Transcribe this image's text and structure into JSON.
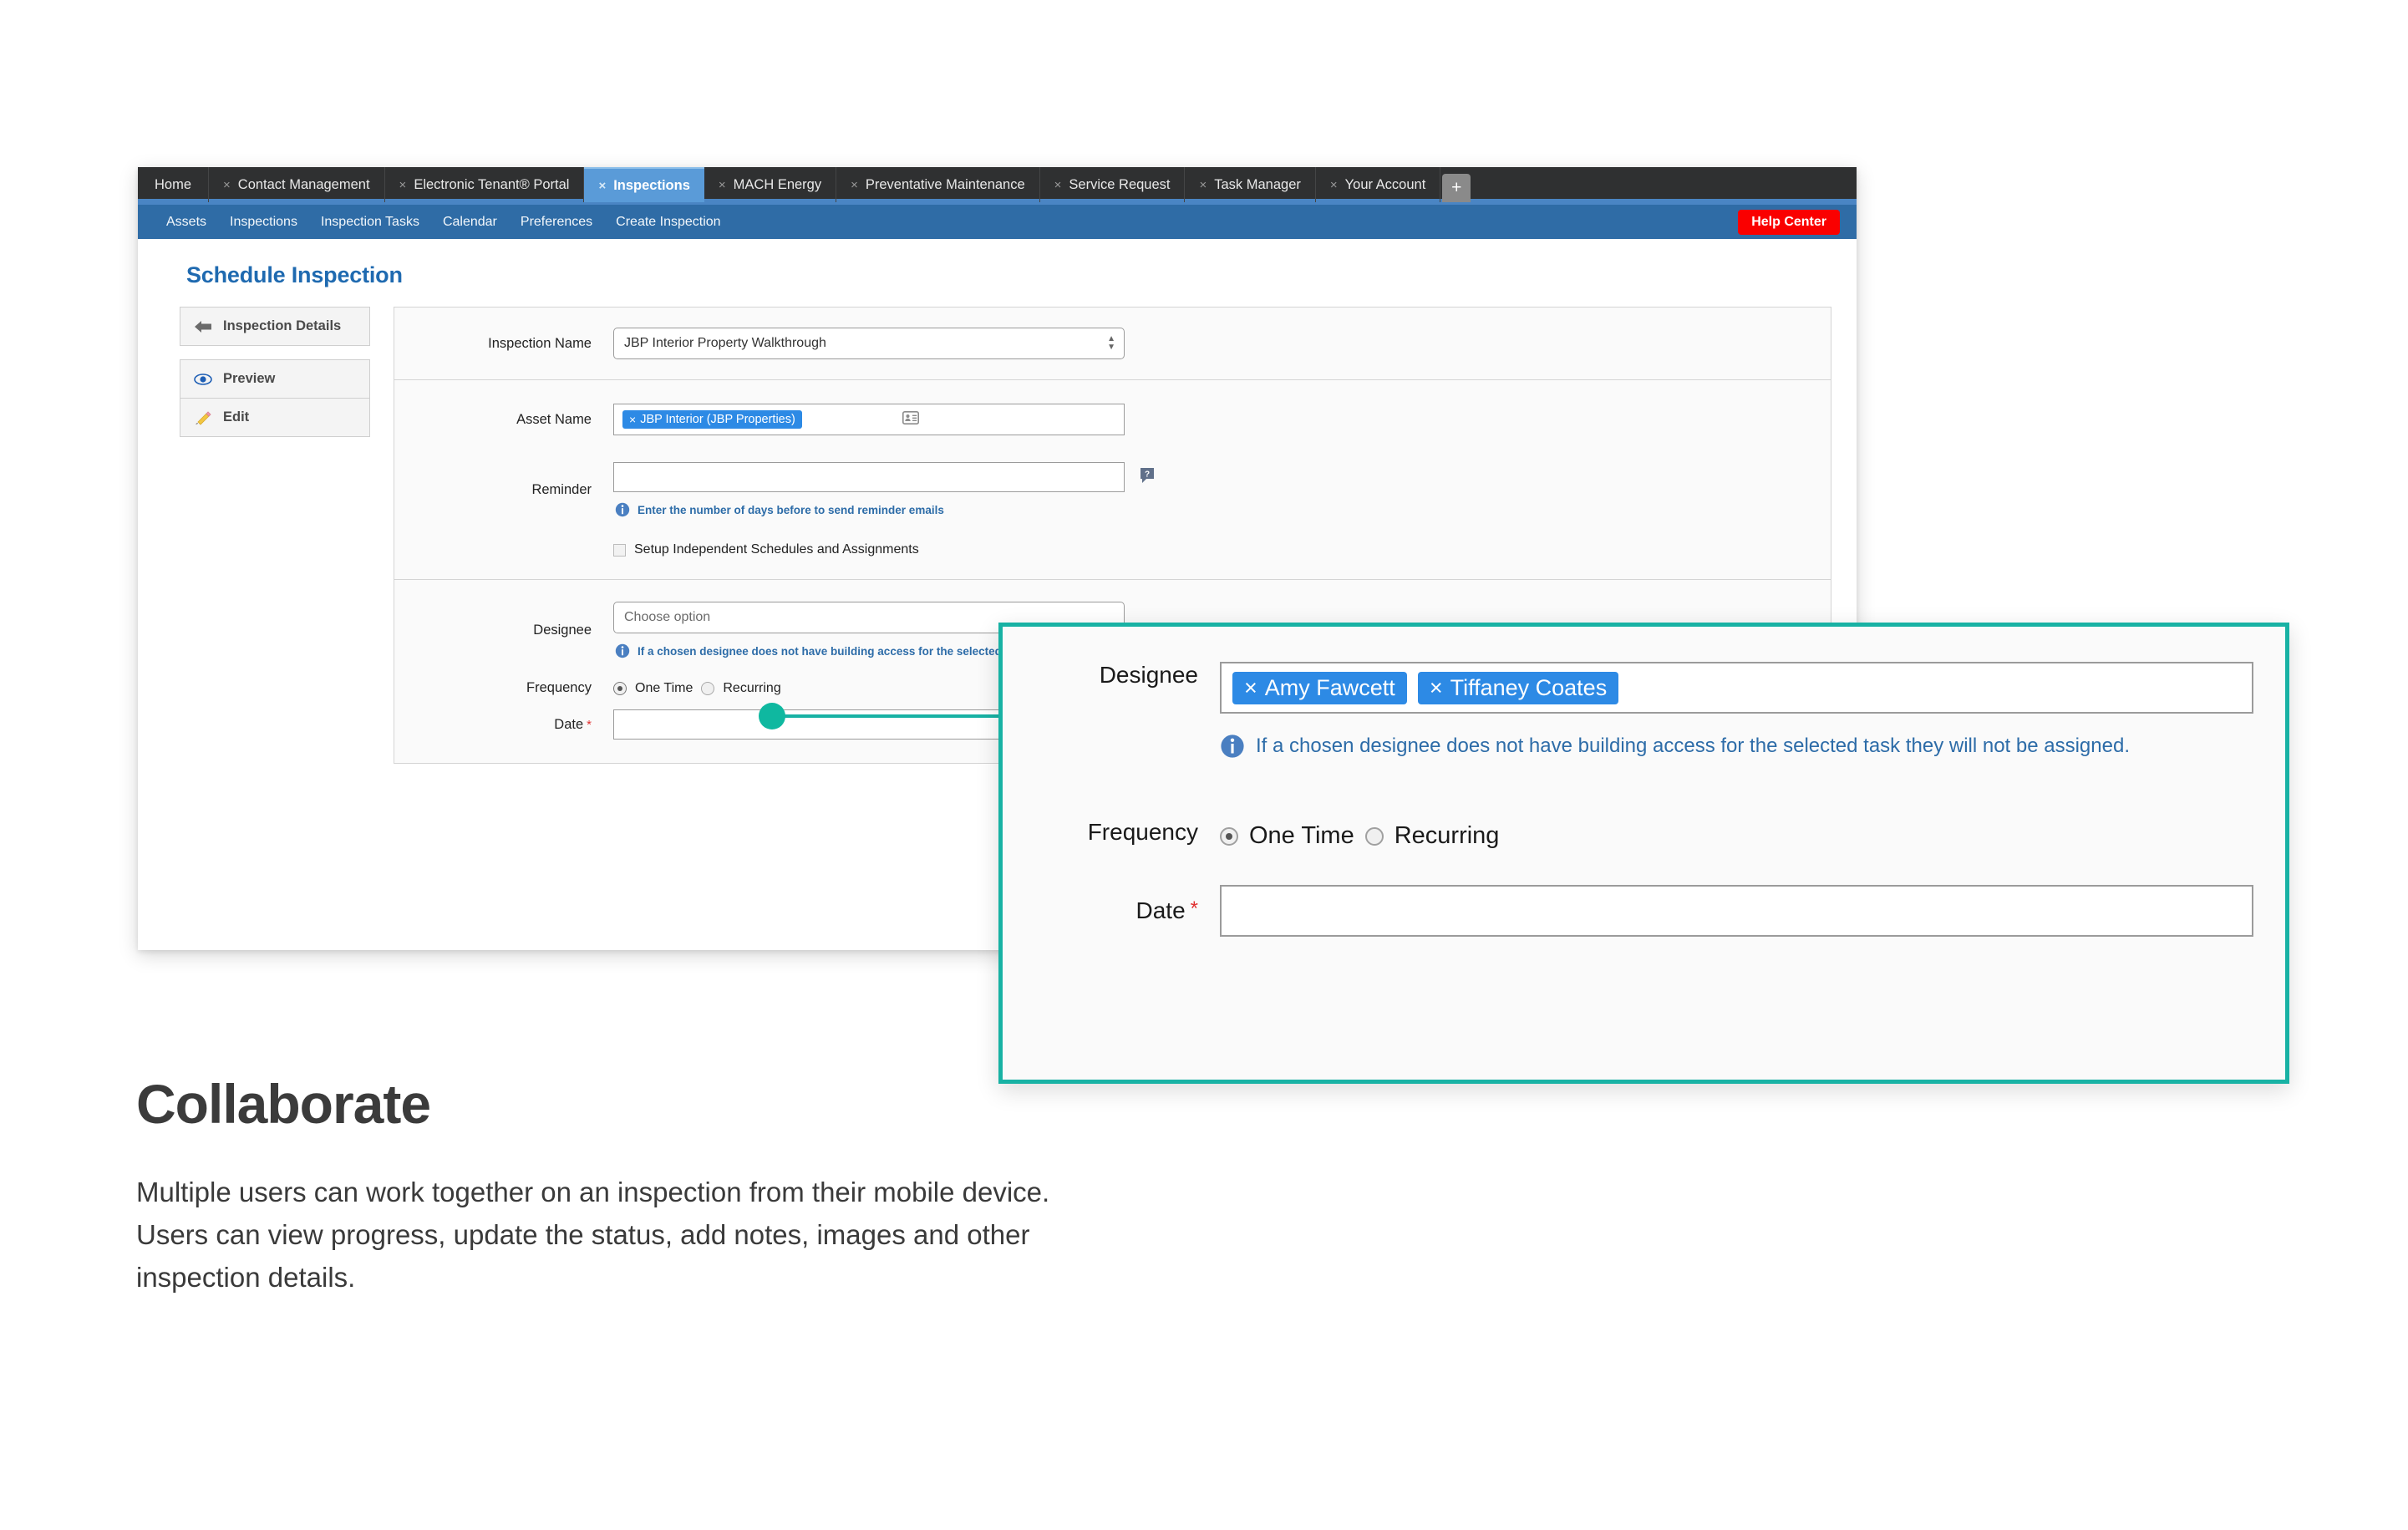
{
  "browser": {
    "tabs": [
      {
        "label": "Home",
        "closable": false,
        "active": false
      },
      {
        "label": "Contact Management",
        "closable": true,
        "active": false
      },
      {
        "label": "Electronic Tenant® Portal",
        "closable": true,
        "active": false
      },
      {
        "label": "Inspections",
        "closable": true,
        "active": true
      },
      {
        "label": "MACH Energy",
        "closable": true,
        "active": false
      },
      {
        "label": "Preventative Maintenance",
        "closable": true,
        "active": false
      },
      {
        "label": "Service Request",
        "closable": true,
        "active": false
      },
      {
        "label": "Task Manager",
        "closable": true,
        "active": false
      },
      {
        "label": "Your Account",
        "closable": true,
        "active": false
      }
    ],
    "new_tab_label": "+",
    "close_glyph": "×"
  },
  "navbar": {
    "items": [
      "Assets",
      "Inspections",
      "Inspection Tasks",
      "Calendar",
      "Preferences",
      "Create Inspection"
    ],
    "help_button": "Help Center",
    "help_color": "#fa0000",
    "bg_color": "#2f6ca6"
  },
  "page": {
    "title": "Schedule Inspection",
    "title_color": "#1f6ab0"
  },
  "sidenav": {
    "items": [
      {
        "label": "Inspection Details",
        "icon": "back-arrow-icon"
      },
      {
        "label": "Preview",
        "icon": "eye-icon"
      },
      {
        "label": "Edit",
        "icon": "pencil-icon"
      }
    ]
  },
  "form": {
    "inspection_name": {
      "label": "Inspection Name",
      "value": "JBP Interior Property Walkthrough"
    },
    "asset_name": {
      "label": "Asset Name",
      "tokens": [
        "JBP Interior (JBP Properties)"
      ],
      "icon": "address-card-icon"
    },
    "reminder": {
      "label": "Reminder",
      "value": "",
      "icon": "help-bubble-icon",
      "hint": "Enter the number of days before to send reminder emails"
    },
    "independent_schedules": {
      "label": "Setup Independent Schedules and Assignments",
      "checked": false
    },
    "designee": {
      "label": "Designee",
      "placeholder": "Choose option",
      "hint": "If a chosen designee does not have building access for the selected task they will not be assigned."
    },
    "frequency": {
      "label": "Frequency",
      "options": [
        "One Time",
        "Recurring"
      ],
      "selected": "One Time"
    },
    "date": {
      "label": "Date",
      "required_marker": "*",
      "value": ""
    }
  },
  "callout": {
    "accent_color": "#18b2a4",
    "designee": {
      "label": "Designee",
      "tokens": [
        "Amy Fawcett",
        "Tiffaney Coates"
      ],
      "hint": "If a chosen designee does not have building access for the selected task they will not be assigned."
    },
    "frequency": {
      "label": "Frequency",
      "options": [
        "One Time",
        "Recurring"
      ],
      "selected": "One Time"
    },
    "date": {
      "label": "Date",
      "required_marker": "*",
      "value": ""
    },
    "close_glyph": "×"
  },
  "copy": {
    "heading": "Collaborate",
    "body": "Multiple users can work together on an inspection from their mobile device. Users can view progress, update the status, add notes, images and other inspection details."
  }
}
